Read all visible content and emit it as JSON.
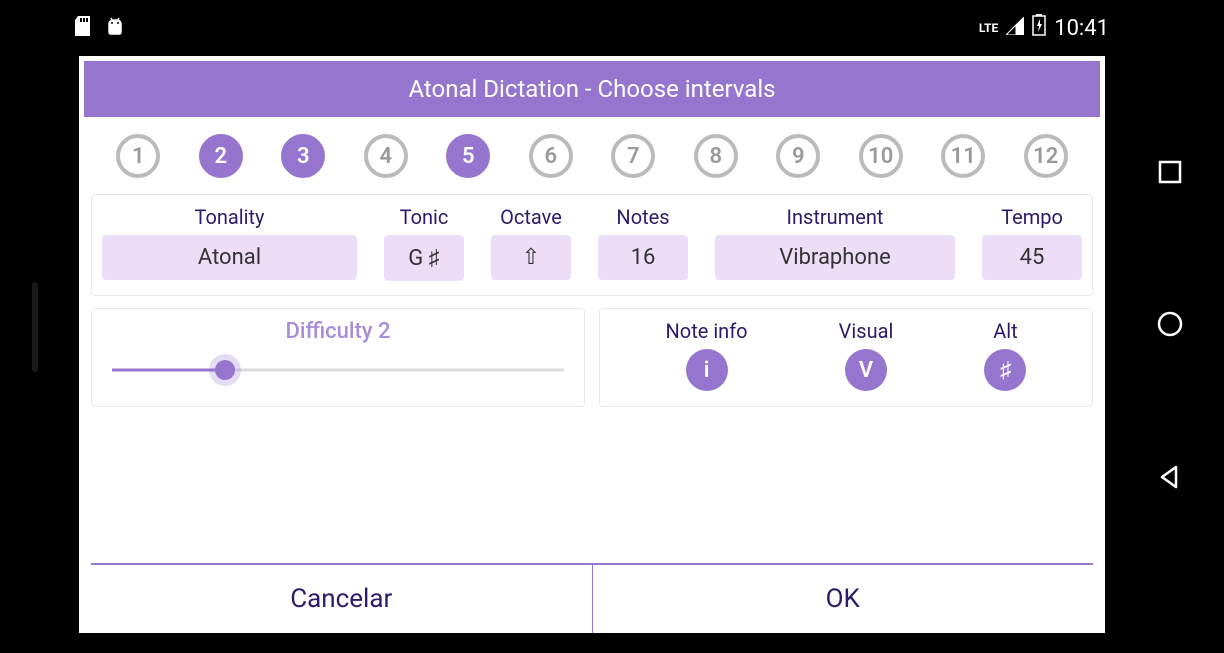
{
  "status": {
    "time": "10:41",
    "lte": "LTE"
  },
  "dialog": {
    "title": "Atonal Dictation - Choose intervals"
  },
  "intervals": [
    {
      "n": "1",
      "selected": false
    },
    {
      "n": "2",
      "selected": true
    },
    {
      "n": "3",
      "selected": true
    },
    {
      "n": "4",
      "selected": false
    },
    {
      "n": "5",
      "selected": true
    },
    {
      "n": "6",
      "selected": false
    },
    {
      "n": "7",
      "selected": false
    },
    {
      "n": "8",
      "selected": false
    },
    {
      "n": "9",
      "selected": false
    },
    {
      "n": "10",
      "selected": false
    },
    {
      "n": "11",
      "selected": false
    },
    {
      "n": "12",
      "selected": false
    }
  ],
  "settings": {
    "tonality": {
      "label": "Tonality",
      "value": "Atonal"
    },
    "tonic": {
      "label": "Tonic",
      "value": "G ♯"
    },
    "octave": {
      "label": "Octave",
      "value": "⇧"
    },
    "notes": {
      "label": "Notes",
      "value": "16"
    },
    "instrument": {
      "label": "Instrument",
      "value": "Vibraphone"
    },
    "tempo": {
      "label": "Tempo",
      "value": "45"
    }
  },
  "difficulty": {
    "label": "Difficulty 2",
    "percent": 25
  },
  "options": {
    "noteinfo": {
      "label": "Note info",
      "glyph": "i"
    },
    "visual": {
      "label": "Visual",
      "glyph": "V"
    },
    "alt": {
      "label": "Alt",
      "glyph": "♯"
    }
  },
  "footer": {
    "cancel": "Cancelar",
    "ok": "OK"
  }
}
